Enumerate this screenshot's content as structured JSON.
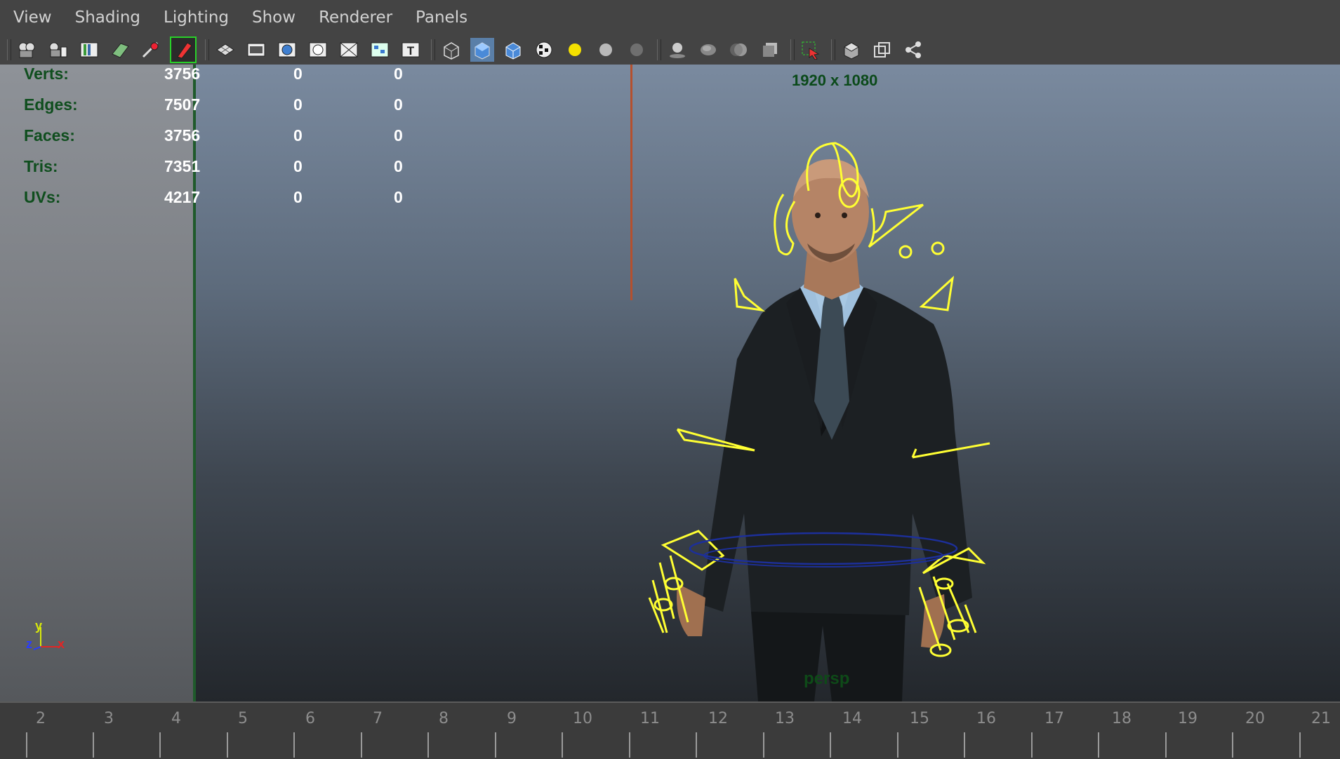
{
  "menu": [
    "View",
    "Shading",
    "Lighting",
    "Show",
    "Renderer",
    "Panels"
  ],
  "toolbar_icons": [
    "camera-select-icon",
    "camera-attributes-icon",
    "bookmarks-icon",
    "image-plane-icon",
    "2d-pan-zoom-icon",
    "grease-pencil-icon",
    "grid-icon",
    "film-gate-icon",
    "resolution-gate-icon",
    "gate-mask-icon",
    "field-chart-icon",
    "safe-action-icon",
    "safe-title-icon",
    "wireframe-icon",
    "smooth-shade-icon",
    "wireframe-on-shaded-icon",
    "textured-icon",
    "default-lighting-icon",
    "all-lights-icon",
    "flat-lighting-icon",
    "shadows-icon",
    "screen-space-ao-icon",
    "motion-blur-icon",
    "anti-aliasing-icon",
    "isolate-select-icon",
    "xray-icon",
    "xray-active-components-icon",
    "xray-joints-icon"
  ],
  "hud": {
    "verts": {
      "label": "Verts:",
      "v1": "3756",
      "v2": "0",
      "v3": "0"
    },
    "edges": {
      "label": "Edges:",
      "v1": "7507",
      "v2": "0",
      "v3": "0"
    },
    "faces": {
      "label": "Faces:",
      "v1": "3756",
      "v2": "0",
      "v3": "0"
    },
    "tris": {
      "label": "Tris:",
      "v1": "7351",
      "v2": "0",
      "v3": "0"
    },
    "uvs": {
      "label": "UVs:",
      "v1": "4217",
      "v2": "0",
      "v3": "0"
    }
  },
  "resolution": "1920 x 1080",
  "camera_name": "persp",
  "axis": {
    "y": "y",
    "z": "z",
    "x": "x"
  },
  "timeline_numbers": [
    "2",
    "3",
    "4",
    "5",
    "6",
    "7",
    "8",
    "9",
    "10",
    "11",
    "12",
    "13",
    "14",
    "15",
    "16",
    "17",
    "18",
    "19",
    "20",
    "21"
  ],
  "colors": {
    "hud_label": "#0f4e1e",
    "rig_controls": "#ffff33",
    "accent_red": "#b5502e"
  }
}
